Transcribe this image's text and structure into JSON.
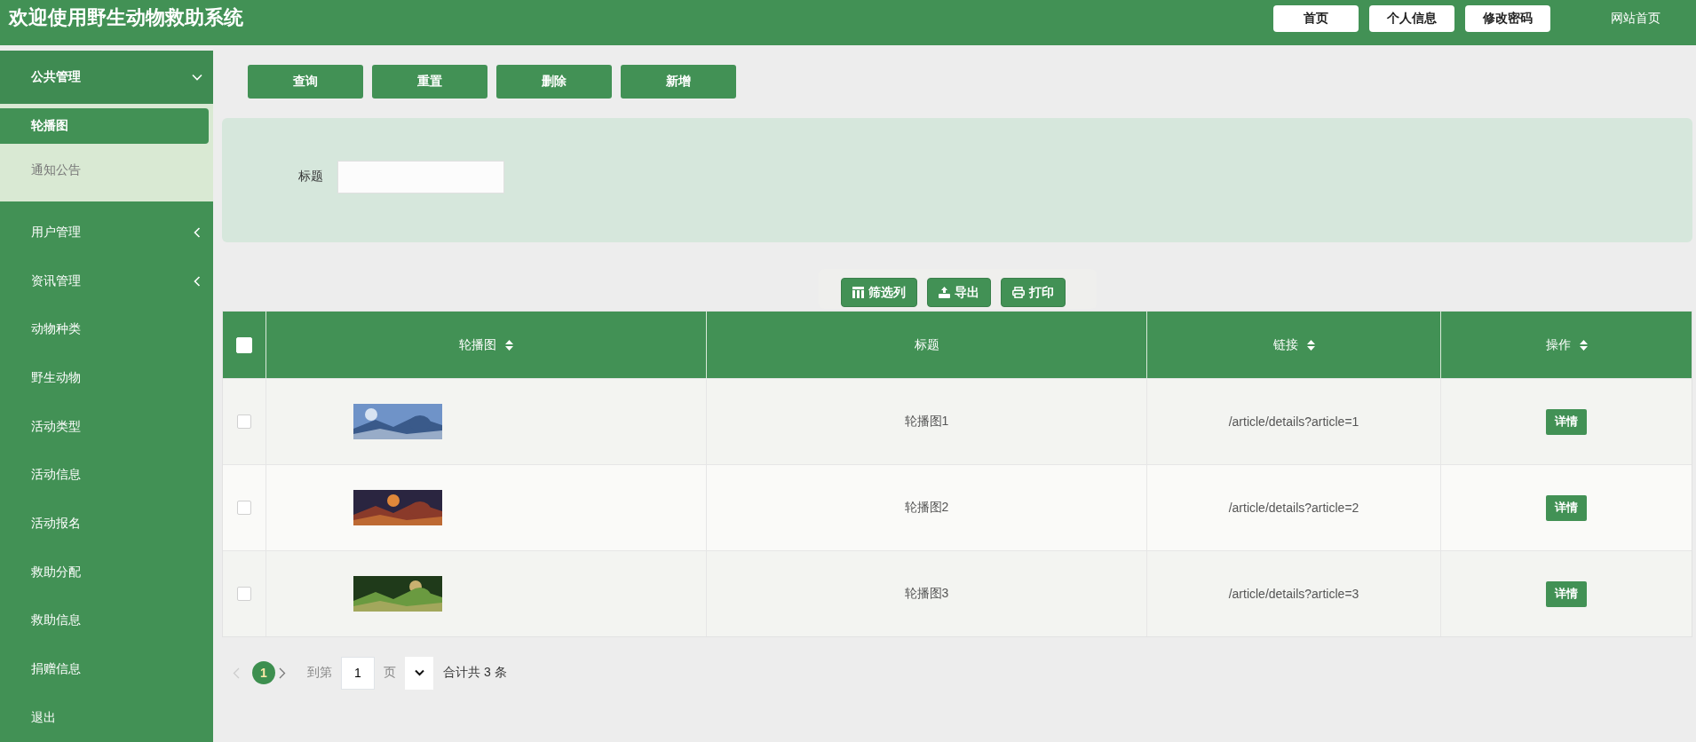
{
  "header": {
    "title": "欢迎使用野生动物救助系统",
    "buttons": [
      "首页",
      "个人信息",
      "修改密码"
    ],
    "link": "网站首页"
  },
  "sidebar": {
    "items": [
      {
        "kind": "group",
        "label": "公共管理",
        "expanded": true,
        "children": [
          {
            "label": "轮播图",
            "selected": true
          },
          {
            "label": "通知公告",
            "selected": false
          }
        ]
      },
      {
        "kind": "group",
        "label": "用户管理",
        "expanded": false
      },
      {
        "kind": "group",
        "label": "资讯管理",
        "expanded": false
      },
      {
        "kind": "item",
        "label": "动物种类"
      },
      {
        "kind": "item",
        "label": "野生动物"
      },
      {
        "kind": "item",
        "label": "活动类型"
      },
      {
        "kind": "item",
        "label": "活动信息"
      },
      {
        "kind": "item",
        "label": "活动报名"
      },
      {
        "kind": "item",
        "label": "救助分配"
      },
      {
        "kind": "item",
        "label": "救助信息"
      },
      {
        "kind": "item",
        "label": "捐赠信息"
      },
      {
        "kind": "item",
        "label": "退出"
      }
    ]
  },
  "actions": [
    "查询",
    "重置",
    "删除",
    "新增"
  ],
  "search": {
    "label": "标题"
  },
  "tools": [
    {
      "kind": "columns",
      "label": "筛选列"
    },
    {
      "kind": "export",
      "label": "导出"
    },
    {
      "kind": "print",
      "label": "打印"
    }
  ],
  "table": {
    "select_all_checked": false,
    "columns": [
      {
        "label": "轮播图",
        "sortable": true
      },
      {
        "label": "标题",
        "sortable": false
      },
      {
        "label": "链接",
        "sortable": true
      },
      {
        "label": "操作",
        "sortable": true
      }
    ],
    "rows": [
      {
        "checked": false,
        "title": "轮播图1",
        "link": "/article/details?article=1",
        "action": "详情"
      },
      {
        "checked": false,
        "title": "轮播图2",
        "link": "/article/details?article=2",
        "action": "详情"
      },
      {
        "checked": false,
        "title": "轮播图3",
        "link": "/article/details?article=3",
        "action": "详情"
      }
    ]
  },
  "pagination": {
    "prev_disabled": true,
    "pages": [
      {
        "label": "1",
        "selected": true
      }
    ],
    "goto_label": "到第",
    "goto_value": "1",
    "page_label": "页",
    "total": "合计共 3 条"
  }
}
